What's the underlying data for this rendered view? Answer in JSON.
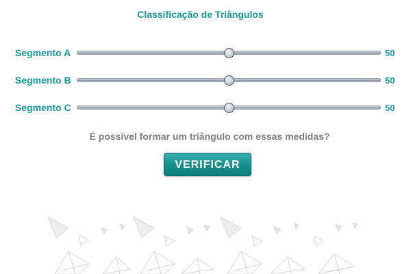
{
  "title": "Classificação de Triângulos",
  "sliders": [
    {
      "label": "Segmento A",
      "value": "50",
      "level": 0.5
    },
    {
      "label": "Segmento B",
      "value": "50",
      "level": 0.5
    },
    {
      "label": "Segmento C",
      "value": "50",
      "level": 0.5
    }
  ],
  "question": "É possivel formar um triângulo com essas medidas?",
  "verify_button": "VERIFICAR",
  "colors": {
    "accent": "#17989a",
    "question_text": "#7d7d7d",
    "button_bg": "#17908f"
  },
  "decoration": "triangle-pattern-icon"
}
